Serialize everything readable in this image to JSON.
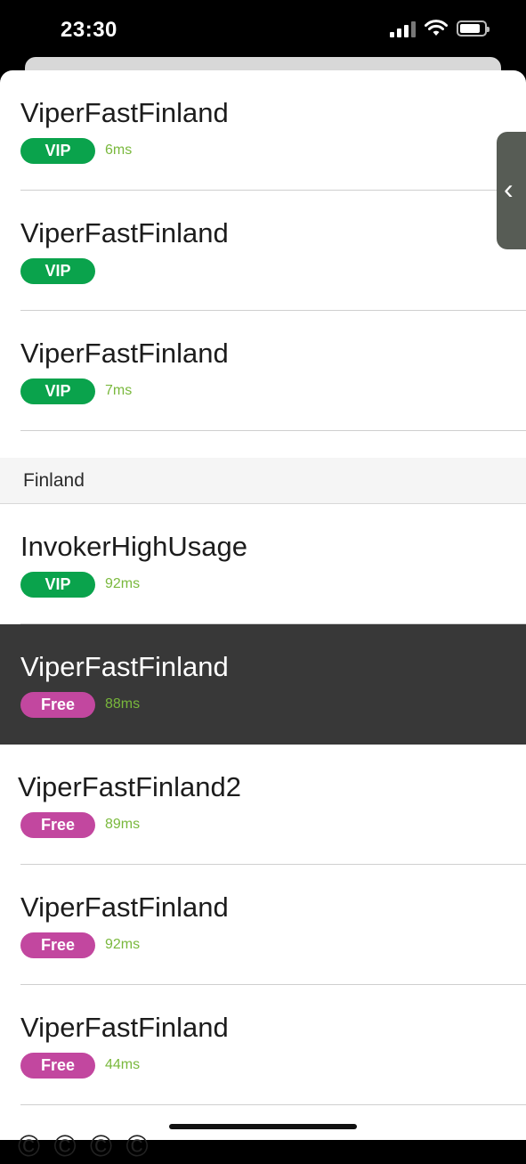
{
  "status": {
    "time": "23:30"
  },
  "servers_top": [
    {
      "name": "ViperFastFinland",
      "badge": "VIP",
      "ping": "6ms"
    },
    {
      "name": "ViperFastFinland",
      "badge": "VIP",
      "ping": ""
    },
    {
      "name": "ViperFastFinland",
      "badge": "VIP",
      "ping": "7ms"
    }
  ],
  "section": {
    "title": "Finland"
  },
  "servers_finland": [
    {
      "name": "InvokerHighUsage",
      "badge": "VIP",
      "ping": "92ms"
    },
    {
      "name": "ViperFastFinland",
      "badge": "Free",
      "ping": "88ms"
    },
    {
      "name": "ViperFastFinland2",
      "badge": "Free",
      "ping": "89ms"
    },
    {
      "name": "ViperFastFinland",
      "badge": "Free",
      "ping": "92ms"
    },
    {
      "name": "ViperFastFinland",
      "badge": "Free",
      "ping": "44ms"
    }
  ],
  "side_handle": {
    "glyph": "‹"
  },
  "bottom_peek": "©  ©  ©  ©",
  "colors": {
    "vip": "#0aa34c",
    "free": "#c2479f",
    "ping": "#79b83c",
    "selected_row": "#383838"
  },
  "icons": [
    "cellular-signal-icon",
    "wifi-icon",
    "battery-icon",
    "chevron-left-icon"
  ]
}
